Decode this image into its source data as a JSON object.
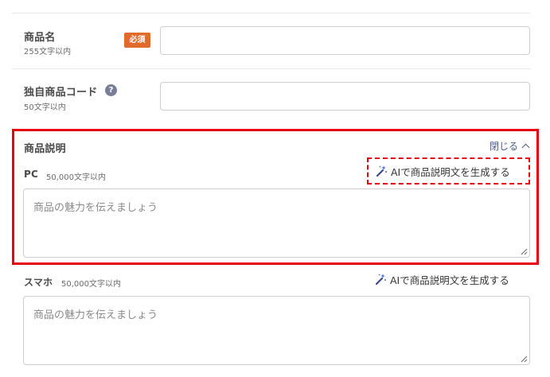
{
  "product_name": {
    "label": "商品名",
    "limit": "255文字以内",
    "badge": "必須",
    "value": ""
  },
  "unique_code": {
    "label": "独自商品コード",
    "limit": "50文字以内",
    "help": "?",
    "value": ""
  },
  "description": {
    "label": "商品説明",
    "toggle": "閉じる",
    "pc": {
      "label": "PC",
      "limit": "50,000文字以内",
      "placeholder": "商品の魅力を伝えましょう",
      "ai_button": "AIで商品説明文を生成する"
    },
    "sp": {
      "label": "スマホ",
      "limit": "50,000文字以内",
      "placeholder": "商品の魅力を伝えましょう",
      "ai_button": "AIで商品説明文を生成する"
    }
  },
  "colors": {
    "badge": "#e06b2d",
    "highlight": "#e60012",
    "link": "#4a5a8a"
  },
  "icons": {
    "ai": "magic-wand-icon",
    "help": "question-circle-icon",
    "toggle": "chevron-up-icon"
  }
}
